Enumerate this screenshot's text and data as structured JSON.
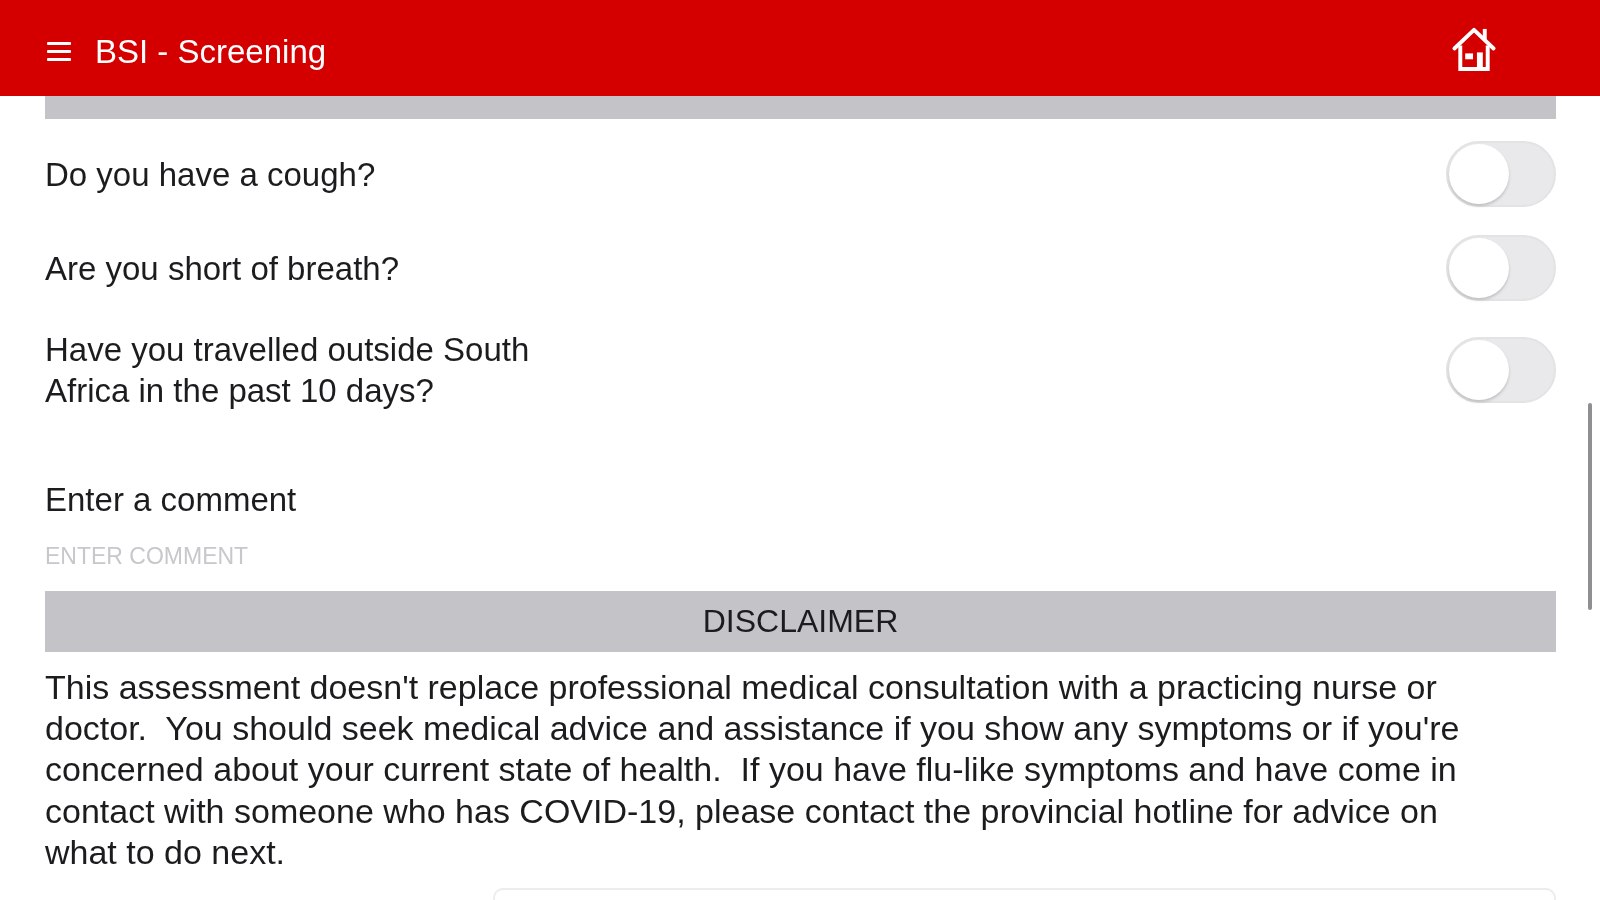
{
  "header": {
    "title": "BSI - Screening"
  },
  "questions": [
    {
      "label": "Do you have a cough?",
      "on": false
    },
    {
      "label": "Are you short of breath?",
      "on": false
    },
    {
      "label": "Have you travelled outside South Africa in the past 10 days?",
      "on": false
    }
  ],
  "comment": {
    "label": "Enter a comment",
    "placeholder": "ENTER COMMENT"
  },
  "disclaimer": {
    "heading": "DISCLAIMER",
    "text": "This assessment doesn't replace professional medical consultation with a practicing nurse or doctor.  You should seek medical advice and assistance if you show any symptoms or if you're concerned about your current state of health.  If you have flu-like symptoms and have come in contact with someone who has COVID-19, please contact the provincial hotline for advice on what to do next."
  }
}
